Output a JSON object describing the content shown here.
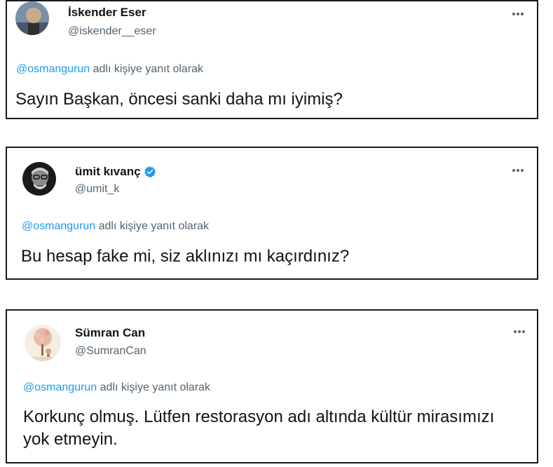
{
  "tweets": [
    {
      "name": "İskender Eser",
      "handle": "@iskender__eser",
      "verified": false,
      "avatar_icon": "profile-photo-man-gray-hair",
      "reply_mention": "@osmangurun",
      "reply_suffix": " adlı kişiye yanıt olarak",
      "text": "Sayın Başkan, öncesi sanki daha mı iyimiş?"
    },
    {
      "name": "ümit kıvanç",
      "handle": "@umit_k",
      "verified": true,
      "avatar_icon": "profile-photo-bw-man-glasses",
      "reply_mention": "@osmangurun",
      "reply_suffix": " adlı kişiye yanıt olarak",
      "text": "Bu hesap fake mi, siz aklınızı mı kaçırdınız?"
    },
    {
      "name": "Sümran Can",
      "handle": "@SumranCan",
      "verified": false,
      "avatar_icon": "profile-illustration-tree-girl",
      "reply_mention": "@osmangurun",
      "reply_suffix": " adlı kişiye yanıt olarak",
      "text": "Korkunç olmuş. Lütfen restorasyon adı altında kültür mirasımızı yok etmeyin."
    }
  ],
  "colors": {
    "mention": "#1d9bf0",
    "secondary_text": "#536471",
    "verified_badge": "#1d9bf0",
    "card_border": "#1a1a1a"
  },
  "icons": {
    "more": "more-options-icon",
    "verified": "verified-badge-icon"
  }
}
